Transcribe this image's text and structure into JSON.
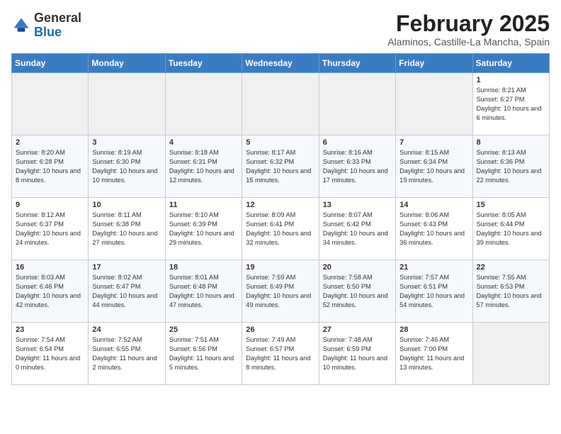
{
  "header": {
    "logo_general": "General",
    "logo_blue": "Blue",
    "title": "February 2025",
    "subtitle": "Alaminos, Castille-La Mancha, Spain"
  },
  "weekdays": [
    "Sunday",
    "Monday",
    "Tuesday",
    "Wednesday",
    "Thursday",
    "Friday",
    "Saturday"
  ],
  "weeks": [
    [
      {
        "day": "",
        "info": ""
      },
      {
        "day": "",
        "info": ""
      },
      {
        "day": "",
        "info": ""
      },
      {
        "day": "",
        "info": ""
      },
      {
        "day": "",
        "info": ""
      },
      {
        "day": "",
        "info": ""
      },
      {
        "day": "1",
        "info": "Sunrise: 8:21 AM\nSunset: 6:27 PM\nDaylight: 10 hours and 6 minutes."
      }
    ],
    [
      {
        "day": "2",
        "info": "Sunrise: 8:20 AM\nSunset: 6:28 PM\nDaylight: 10 hours and 8 minutes."
      },
      {
        "day": "3",
        "info": "Sunrise: 8:19 AM\nSunset: 6:30 PM\nDaylight: 10 hours and 10 minutes."
      },
      {
        "day": "4",
        "info": "Sunrise: 8:18 AM\nSunset: 6:31 PM\nDaylight: 10 hours and 12 minutes."
      },
      {
        "day": "5",
        "info": "Sunrise: 8:17 AM\nSunset: 6:32 PM\nDaylight: 10 hours and 15 minutes."
      },
      {
        "day": "6",
        "info": "Sunrise: 8:16 AM\nSunset: 6:33 PM\nDaylight: 10 hours and 17 minutes."
      },
      {
        "day": "7",
        "info": "Sunrise: 8:15 AM\nSunset: 6:34 PM\nDaylight: 10 hours and 19 minutes."
      },
      {
        "day": "8",
        "info": "Sunrise: 8:13 AM\nSunset: 6:36 PM\nDaylight: 10 hours and 22 minutes."
      }
    ],
    [
      {
        "day": "9",
        "info": "Sunrise: 8:12 AM\nSunset: 6:37 PM\nDaylight: 10 hours and 24 minutes."
      },
      {
        "day": "10",
        "info": "Sunrise: 8:11 AM\nSunset: 6:38 PM\nDaylight: 10 hours and 27 minutes."
      },
      {
        "day": "11",
        "info": "Sunrise: 8:10 AM\nSunset: 6:39 PM\nDaylight: 10 hours and 29 minutes."
      },
      {
        "day": "12",
        "info": "Sunrise: 8:09 AM\nSunset: 6:41 PM\nDaylight: 10 hours and 32 minutes."
      },
      {
        "day": "13",
        "info": "Sunrise: 8:07 AM\nSunset: 6:42 PM\nDaylight: 10 hours and 34 minutes."
      },
      {
        "day": "14",
        "info": "Sunrise: 8:06 AM\nSunset: 6:43 PM\nDaylight: 10 hours and 36 minutes."
      },
      {
        "day": "15",
        "info": "Sunrise: 8:05 AM\nSunset: 6:44 PM\nDaylight: 10 hours and 39 minutes."
      }
    ],
    [
      {
        "day": "16",
        "info": "Sunrise: 8:03 AM\nSunset: 6:46 PM\nDaylight: 10 hours and 42 minutes."
      },
      {
        "day": "17",
        "info": "Sunrise: 8:02 AM\nSunset: 6:47 PM\nDaylight: 10 hours and 44 minutes."
      },
      {
        "day": "18",
        "info": "Sunrise: 8:01 AM\nSunset: 6:48 PM\nDaylight: 10 hours and 47 minutes."
      },
      {
        "day": "19",
        "info": "Sunrise: 7:59 AM\nSunset: 6:49 PM\nDaylight: 10 hours and 49 minutes."
      },
      {
        "day": "20",
        "info": "Sunrise: 7:58 AM\nSunset: 6:50 PM\nDaylight: 10 hours and 52 minutes."
      },
      {
        "day": "21",
        "info": "Sunrise: 7:57 AM\nSunset: 6:51 PM\nDaylight: 10 hours and 54 minutes."
      },
      {
        "day": "22",
        "info": "Sunrise: 7:55 AM\nSunset: 6:53 PM\nDaylight: 10 hours and 57 minutes."
      }
    ],
    [
      {
        "day": "23",
        "info": "Sunrise: 7:54 AM\nSunset: 6:54 PM\nDaylight: 11 hours and 0 minutes."
      },
      {
        "day": "24",
        "info": "Sunrise: 7:52 AM\nSunset: 6:55 PM\nDaylight: 11 hours and 2 minutes."
      },
      {
        "day": "25",
        "info": "Sunrise: 7:51 AM\nSunset: 6:56 PM\nDaylight: 11 hours and 5 minutes."
      },
      {
        "day": "26",
        "info": "Sunrise: 7:49 AM\nSunset: 6:57 PM\nDaylight: 11 hours and 8 minutes."
      },
      {
        "day": "27",
        "info": "Sunrise: 7:48 AM\nSunset: 6:59 PM\nDaylight: 11 hours and 10 minutes."
      },
      {
        "day": "28",
        "info": "Sunrise: 7:46 AM\nSunset: 7:00 PM\nDaylight: 11 hours and 13 minutes."
      },
      {
        "day": "",
        "info": ""
      }
    ]
  ]
}
